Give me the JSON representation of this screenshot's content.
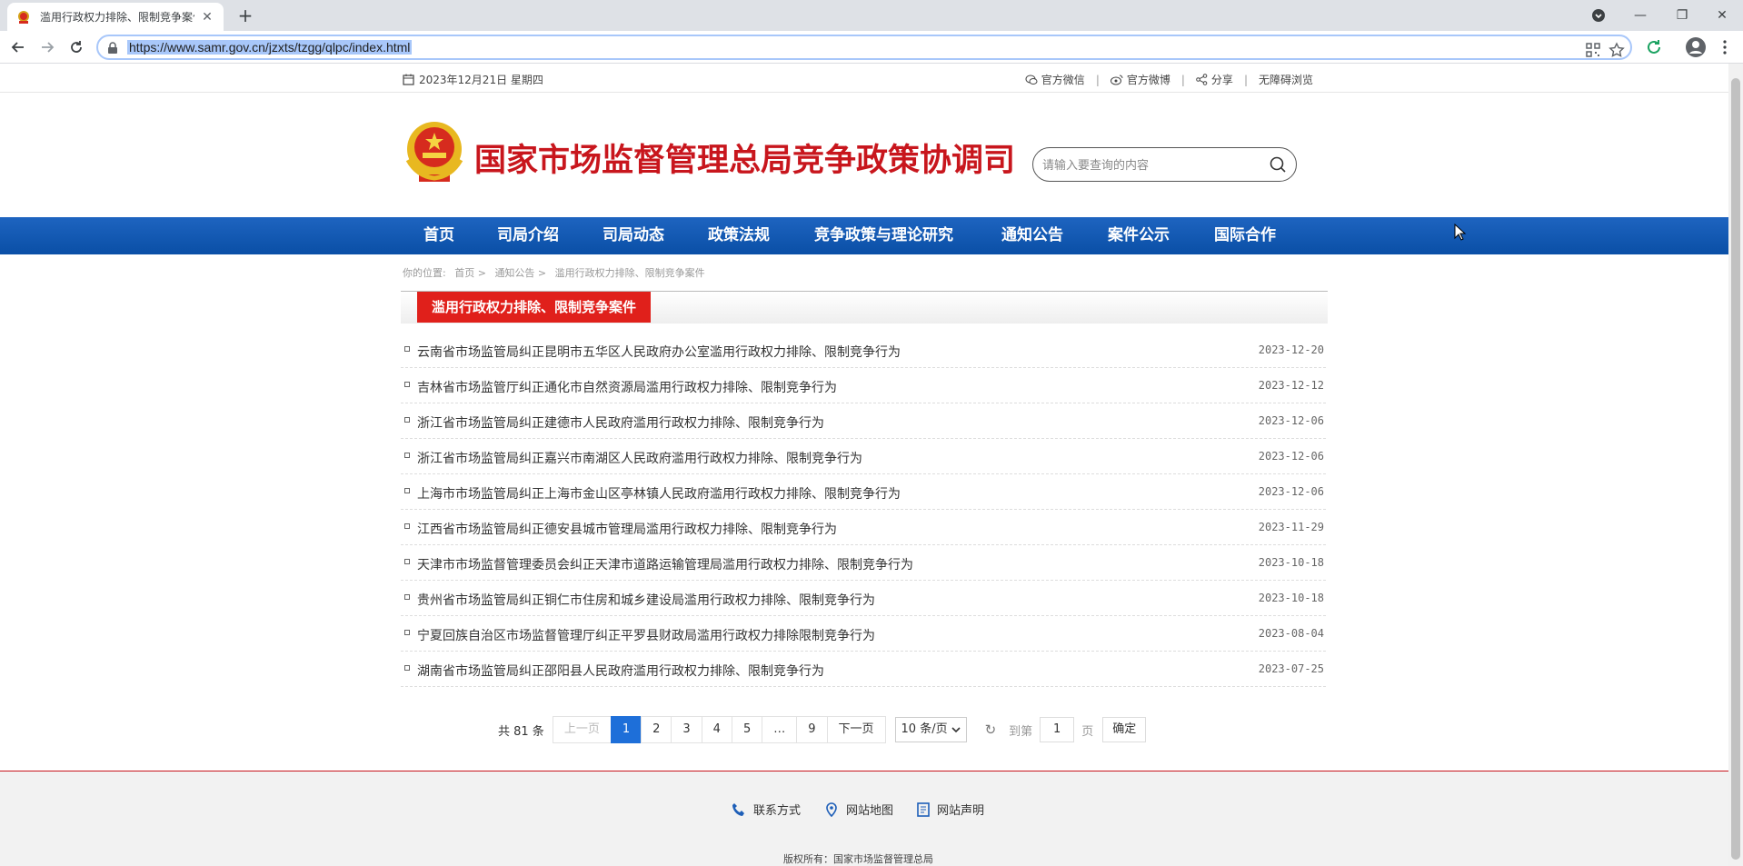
{
  "browser": {
    "tab_title": "滥用行政权力排除、限制竞争案件",
    "url": "https://www.samr.gov.cn/jzxts/tzgg/qlpc/index.html"
  },
  "topbar": {
    "date": "2023年12月21日 星期四",
    "links": [
      "官方微信",
      "官方微博",
      "分享",
      "无障碍浏览"
    ]
  },
  "header": {
    "site_title": "国家市场监督管理总局竞争政策协调司",
    "search_placeholder": "请输入要查询的内容"
  },
  "nav": [
    "首页",
    "司局介绍",
    "司局动态",
    "政策法规",
    "竞争政策与理论研究",
    "通知公告",
    "案件公示",
    "国际合作"
  ],
  "breadcrumb": {
    "prefix": "你的位置:",
    "items": [
      "首页 >",
      "通知公告 >",
      "滥用行政权力排除、限制竞争案件"
    ]
  },
  "section_title": "滥用行政权力排除、限制竞争案件",
  "articles": [
    {
      "title": "云南省市场监管局纠正昆明市五华区人民政府办公室滥用行政权力排除、限制竞争行为",
      "date": "2023-12-20"
    },
    {
      "title": "吉林省市场监管厅纠正通化市自然资源局滥用行政权力排除、限制竞争行为",
      "date": "2023-12-12"
    },
    {
      "title": "浙江省市场监管局纠正建德市人民政府滥用行政权力排除、限制竞争行为",
      "date": "2023-12-06"
    },
    {
      "title": "浙江省市场监管局纠正嘉兴市南湖区人民政府滥用行政权力排除、限制竞争行为",
      "date": "2023-12-06"
    },
    {
      "title": "上海市市场监管局纠正上海市金山区亭林镇人民政府滥用行政权力排除、限制竞争行为",
      "date": "2023-12-06"
    },
    {
      "title": "江西省市场监管局纠正德安县城市管理局滥用行政权力排除、限制竞争行为",
      "date": "2023-11-29"
    },
    {
      "title": "天津市市场监督管理委员会纠正天津市道路运输管理局滥用行政权力排除、限制竞争行为",
      "date": "2023-10-18"
    },
    {
      "title": "贵州省市场监管局纠正铜仁市住房和城乡建设局滥用行政权力排除、限制竞争行为",
      "date": "2023-10-18"
    },
    {
      "title": "宁夏回族自治区市场监督管理厅纠正平罗县财政局滥用行政权力排除限制竞争行为",
      "date": "2023-08-04"
    },
    {
      "title": "湖南省市场监管局纠正邵阳县人民政府滥用行政权力排除、限制竞争行为",
      "date": "2023-07-25"
    }
  ],
  "pager": {
    "total": "共 81 条",
    "prev": "上一页",
    "pages": [
      "1",
      "2",
      "3",
      "4",
      "5",
      "…",
      "9"
    ],
    "current": "1",
    "next": "下一页",
    "per_page": "10 条/页",
    "goto_label": "到第",
    "goto_value": "1",
    "page_unit": "页",
    "confirm": "确定"
  },
  "footer": {
    "links": [
      "联系方式",
      "网站地图",
      "网站声明"
    ],
    "copyright": "版权所有：国家市场监督管理总局"
  },
  "colors": {
    "nav_blue": "#0a4fa6",
    "brand_red": "#c8161d",
    "pager_active": "#1e6fd9"
  }
}
